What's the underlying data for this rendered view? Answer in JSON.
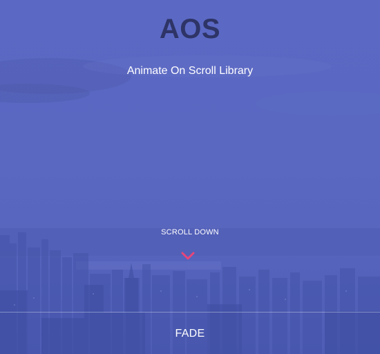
{
  "hero": {
    "title": "AOS",
    "subtitle": "Animate On Scroll Library",
    "scroll_label": "SCROLL DOWN",
    "scroll_icon": "chevron-down-icon"
  },
  "section": {
    "label": "FADE"
  },
  "colors": {
    "background": "#5a68c2",
    "title": "#2e3466",
    "text": "#ffffff",
    "accent": "#e8457a"
  }
}
